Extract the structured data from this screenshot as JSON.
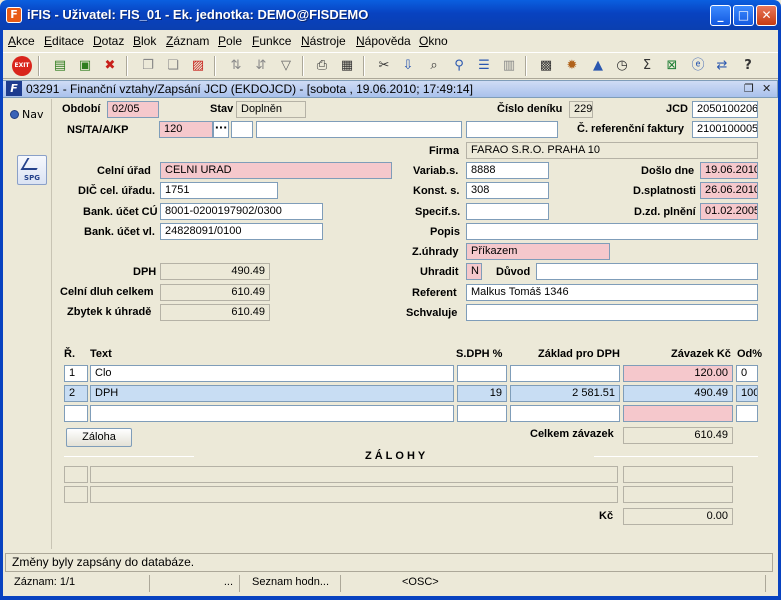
{
  "window": {
    "title": "iFIS - Uživatel: FIS_01 - Ek. jednotka: DEMO@FISDEMO",
    "logo": "F"
  },
  "menu": [
    {
      "u": "A",
      "rest": "kce"
    },
    {
      "u": "E",
      "rest": "ditace"
    },
    {
      "u": "D",
      "rest": "otaz"
    },
    {
      "u": "B",
      "rest": "lok"
    },
    {
      "u": "Z",
      "rest": "áznam"
    },
    {
      "u": "P",
      "rest": "ole"
    },
    {
      "u": "F",
      "rest": "unkce"
    },
    {
      "u": "N",
      "rest": "ástroje"
    },
    {
      "u": "N",
      "rest": "ápověda"
    },
    {
      "u": "O",
      "rest": "kno"
    }
  ],
  "toolbar_icons": [
    "exit-icon",
    "insert-record-icon",
    "save-icon",
    "delete-record-icon",
    "copy-icon",
    "copy-record-icon",
    "clear-icon",
    "sort-asc-icon",
    "sort-desc-icon",
    "filter-icon",
    "print-icon",
    "print-preview-icon",
    "cut-icon",
    "paste-icon",
    "search-icon",
    "find-icon",
    "list-icon",
    "columns-icon",
    "calculator-icon",
    "settings-icon",
    "account-icon",
    "clock-icon",
    "sum-icon",
    "excel-icon",
    "browser-icon",
    "transfer-icon",
    "help-icon"
  ],
  "toolbar_exit_label": "EXIT",
  "form": {
    "title": "03291 - Finanční vztahy/Zapsání JCD (EKDOJCD) - [sobota , 19.06.2010; 17:49:14]",
    "icon": "F",
    "nav_label": "Nav",
    "spg_label": "SPG",
    "labels": {
      "obdobi": "Období",
      "stav": "Stav",
      "cislo_deniku": "Číslo deníku",
      "jcd": "JCD",
      "ns": "NS/TA/A/KP",
      "c_ref": "Č. referenční faktury",
      "firma": "Firma",
      "celni_urad": "Celní úřad",
      "variab": "Variab.s.",
      "doslo": "Došlo dne",
      "dic": "DIČ cel. úřadu.",
      "konst": "Konst. s.",
      "dsplat": "D.splatnosti",
      "bank_cu": "Bank. účet CÚ",
      "specif": "Specif.s.",
      "dzd": "D.zd. plnění",
      "bank_vl": "Bank. účet vl.",
      "popis": "Popis",
      "zuhrady": "Z.úhrady",
      "dph": "DPH",
      "uhradit": "Uhradit",
      "duvod": "Důvod",
      "celni_dluh": "Celní dluh celkem",
      "referent": "Referent",
      "zbytek": "Zbytek k úhradě",
      "schvaluje": "Schvaluje"
    },
    "values": {
      "obdobi": "02/05",
      "stav": "Doplněn",
      "cislo_deniku": "229",
      "jcd": "2050100206",
      "ns": "120",
      "c_ref": "2100100005",
      "firma": "FARAO S.R.O. PRAHA 10",
      "celni_urad": "CELNI URAD",
      "variab": "8888",
      "doslo": "19.06.2010",
      "dic": "1751",
      "konst": "308",
      "dsplat": "26.06.2010",
      "bank_cu": "8001-0200197902/0300",
      "dzd": "01.02.2005",
      "bank_vl": "24828091/0100",
      "zuhrady": "Příkazem",
      "dph": "490.49",
      "uhradit": "N",
      "celni_dluh": "610.49",
      "referent": "Malkus Tomáš 1346",
      "zbytek": "610.49"
    }
  },
  "items": {
    "headers": {
      "r": "Ř.",
      "text": "Text",
      "sdph": "S.DPH %",
      "zaklad": "Základ pro DPH",
      "zavazek": "Závazek Kč",
      "od": "Od%"
    },
    "rows": [
      {
        "r": "1",
        "text": "Clo",
        "sdph": "",
        "zaklad": "",
        "zavazek": "120.00",
        "od": "0"
      },
      {
        "r": "2",
        "text": "DPH",
        "sdph": "19",
        "zaklad": "2 581.51",
        "zavazek": "490.49",
        "od": "100"
      },
      {
        "r": "",
        "text": "",
        "sdph": "",
        "zaklad": "",
        "zavazek": "",
        "od": ""
      }
    ],
    "zaloha_button": "Záloha",
    "celkem_label": "Celkem závazek",
    "celkem_value": "610.49"
  },
  "zalohy": {
    "title": "ZÁLOHY",
    "kc_label": "Kč",
    "kc_value": "0.00"
  },
  "status": {
    "message": "Změny byly zapsány do databáze.",
    "record": "Záznam: 1/1",
    "ellipsis": "...",
    "list": "Seznam hodn...",
    "osc": "<OSC>"
  }
}
